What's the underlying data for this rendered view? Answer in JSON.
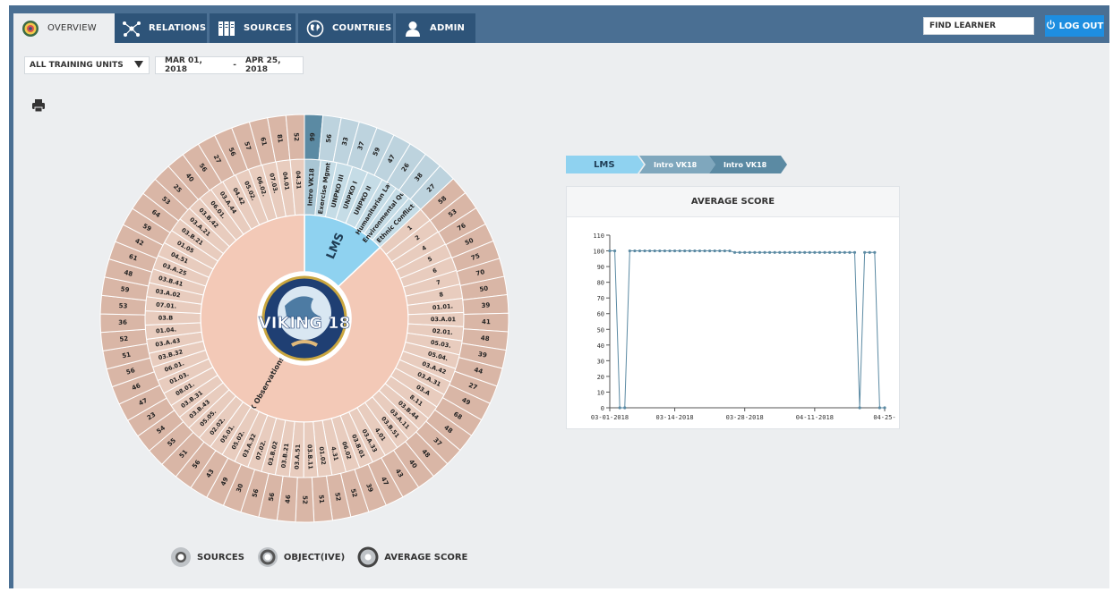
{
  "nav": {
    "tabs": [
      {
        "label": "OVERVIEW",
        "icon": "target-icon",
        "active": true
      },
      {
        "label": "RELATIONS",
        "icon": "network-icon",
        "active": false
      },
      {
        "label": "SOURCES",
        "icon": "books-icon",
        "active": false
      },
      {
        "label": "COUNTRIES",
        "icon": "globe-icon",
        "active": false
      },
      {
        "label": "ADMIN",
        "icon": "user-icon",
        "active": false
      }
    ],
    "find_learner": "FIND LEARNER",
    "logout": "LOG OUT"
  },
  "filters": {
    "units": "ALL TRAINING UNITS",
    "date_from": "MAR 01, 2018",
    "date_sep": "-",
    "date_to": "APR 25, 2018"
  },
  "sunburst": {
    "center_logo": "VIKING 18",
    "inner": [
      {
        "label": "LMS",
        "share": 0.13,
        "color": "#8fd2f0"
      },
      {
        "label": "CAX Observations",
        "share": 0.87,
        "color": "#f3c9b7"
      }
    ],
    "lms_middle": [
      "Intro VK18",
      "Exercise Mgmt",
      "UNPKO III",
      "UNPKO I",
      "UNPKO II",
      "Humanitarian Law",
      "Environmental Quiz",
      "Ethnic Conflict"
    ],
    "lms_outer": [
      "99",
      "56",
      "33",
      "37",
      "59",
      "47",
      "26",
      "38",
      "27"
    ],
    "cax_middle": [
      "1",
      "2",
      "4",
      "5",
      "6",
      "7",
      "8",
      "01.01.",
      "03.A.01",
      "02.01.",
      "05.03.",
      "05.04.",
      "03.A.42",
      "03.A.31",
      "03.A",
      "8.11",
      "03.B.44",
      "03.A.11",
      "03.B.51",
      "4.01",
      "03.A.33",
      "03.B.01",
      "06.02",
      "4.31",
      "01.02",
      "03.B.11",
      "03.A.51",
      "03.B.21",
      "03.B.02",
      "07.02.",
      "03.A.32",
      "05.02.",
      "05.01.",
      "02.02.",
      "05.05.",
      "03.B.43",
      "03.B.31",
      "08.01.",
      "01.03.",
      "06.01.",
      "03.B.32",
      "03.A.43",
      "01.04.",
      "03.B",
      "07.01.",
      "03.A.02",
      "03.B.41",
      "03.A.25",
      "04.51",
      "01.05",
      "03.B.21",
      "03.A.21",
      "03.B.42",
      "06.01.",
      "03.A.44",
      "04.42",
      "05.02.",
      "06.02.",
      "07.03.",
      "04.01",
      "04.31"
    ],
    "cax_outer": [
      "58",
      "53",
      "76",
      "50",
      "75",
      "70",
      "50",
      "39",
      "41",
      "48",
      "39",
      "44",
      "27",
      "49",
      "68",
      "48",
      "37",
      "48",
      "40",
      "43",
      "47",
      "39",
      "52",
      "52",
      "51",
      "52",
      "46",
      "56",
      "56",
      "30",
      "49",
      "43",
      "56",
      "51",
      "55",
      "54",
      "23",
      "47",
      "46",
      "56",
      "51",
      "52",
      "36",
      "53",
      "59",
      "48",
      "61",
      "42",
      "59",
      "64",
      "53",
      "25",
      "40",
      "56",
      "27",
      "56",
      "57",
      "61",
      "81",
      "52"
    ],
    "colors": {
      "lms_mid": "#c5dce6",
      "lms_outer": "#bdd3de",
      "lms_highlight": "#5b8aa3",
      "cax_mid": "#e8ccbe",
      "cax_outer": "#d9b6a6"
    }
  },
  "legend": [
    "SOURCES",
    "OBJECT(IVE)",
    "AVERAGE SCORE"
  ],
  "breadcrumb": [
    "LMS",
    "Intro VK18",
    "Intro VK18"
  ],
  "chart_card": {
    "title": "AVERAGE SCORE"
  },
  "chart_data": {
    "type": "line",
    "title": "AVERAGE SCORE",
    "x_ticks": [
      "03-01-2018",
      "03-14-2018",
      "03-28-2018",
      "04-11-2018",
      "04-25-"
    ],
    "y_ticks": [
      "0",
      "10",
      "20",
      "30",
      "40",
      "50",
      "60",
      "70",
      "80",
      "90",
      "100",
      "110"
    ],
    "ylim": [
      0,
      110
    ],
    "xlim": [
      "2018-03-01",
      "2018-04-25"
    ],
    "points": [
      {
        "x": "2018-03-01",
        "y": 100
      },
      {
        "x": "2018-03-02",
        "y": 100
      },
      {
        "x": "2018-03-03",
        "y": 0
      },
      {
        "x": "2018-03-04",
        "y": 0
      },
      {
        "x": "2018-03-05",
        "y": 100
      },
      {
        "x": "2018-03-06",
        "y": 100
      },
      {
        "x": "2018-03-07",
        "y": 100
      },
      {
        "x": "2018-03-08",
        "y": 100
      },
      {
        "x": "2018-03-09",
        "y": 100
      },
      {
        "x": "2018-03-10",
        "y": 100
      },
      {
        "x": "2018-03-11",
        "y": 100
      },
      {
        "x": "2018-03-12",
        "y": 100
      },
      {
        "x": "2018-03-13",
        "y": 100
      },
      {
        "x": "2018-03-14",
        "y": 100
      },
      {
        "x": "2018-03-15",
        "y": 100
      },
      {
        "x": "2018-03-16",
        "y": 100
      },
      {
        "x": "2018-03-17",
        "y": 100
      },
      {
        "x": "2018-03-18",
        "y": 100
      },
      {
        "x": "2018-03-19",
        "y": 100
      },
      {
        "x": "2018-03-20",
        "y": 100
      },
      {
        "x": "2018-03-21",
        "y": 100
      },
      {
        "x": "2018-03-22",
        "y": 100
      },
      {
        "x": "2018-03-23",
        "y": 100
      },
      {
        "x": "2018-03-24",
        "y": 100
      },
      {
        "x": "2018-03-25",
        "y": 100
      },
      {
        "x": "2018-03-26",
        "y": 99
      },
      {
        "x": "2018-03-27",
        "y": 99
      },
      {
        "x": "2018-03-28",
        "y": 99
      },
      {
        "x": "2018-03-29",
        "y": 99
      },
      {
        "x": "2018-03-30",
        "y": 99
      },
      {
        "x": "2018-03-31",
        "y": 99
      },
      {
        "x": "2018-04-01",
        "y": 99
      },
      {
        "x": "2018-04-02",
        "y": 99
      },
      {
        "x": "2018-04-03",
        "y": 99
      },
      {
        "x": "2018-04-04",
        "y": 99
      },
      {
        "x": "2018-04-05",
        "y": 99
      },
      {
        "x": "2018-04-06",
        "y": 99
      },
      {
        "x": "2018-04-07",
        "y": 99
      },
      {
        "x": "2018-04-08",
        "y": 99
      },
      {
        "x": "2018-04-09",
        "y": 99
      },
      {
        "x": "2018-04-10",
        "y": 99
      },
      {
        "x": "2018-04-11",
        "y": 99
      },
      {
        "x": "2018-04-12",
        "y": 99
      },
      {
        "x": "2018-04-13",
        "y": 99
      },
      {
        "x": "2018-04-14",
        "y": 99
      },
      {
        "x": "2018-04-15",
        "y": 99
      },
      {
        "x": "2018-04-16",
        "y": 99
      },
      {
        "x": "2018-04-17",
        "y": 99
      },
      {
        "x": "2018-04-18",
        "y": 99
      },
      {
        "x": "2018-04-19",
        "y": 99
      },
      {
        "x": "2018-04-20",
        "y": 0
      },
      {
        "x": "2018-04-21",
        "y": 99
      },
      {
        "x": "2018-04-22",
        "y": 99
      },
      {
        "x": "2018-04-23",
        "y": 99
      },
      {
        "x": "2018-04-24",
        "y": 0
      },
      {
        "x": "2018-04-25",
        "y": 0
      }
    ],
    "line_color": "#5b8aa3",
    "grid": false
  }
}
